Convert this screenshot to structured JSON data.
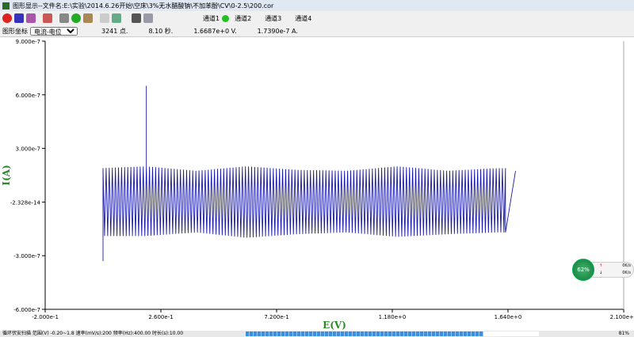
{
  "window": {
    "title": "图形显示--文件名:E:\\实验\\2014.6.26开始\\空床\\3%无水醋酸钠\\不加苯酚\\CV\\0-2.5\\200.cor"
  },
  "toolbar": {
    "channels": [
      "通道1",
      "通道2",
      "通道3",
      "通道4"
    ],
    "active_channel_color": "#22c022"
  },
  "infobar": {
    "label": "图形坐标",
    "mode": "电流-电位",
    "points": "3241 点.",
    "time": "8.10 秒.",
    "potential": "1.6687e+0 V.",
    "current": "1.7390e-7 A."
  },
  "status": {
    "text": "循环伏安扫描  范围(V) -0.20~1.8 速率(mV/s):200 频率(Hz):400.00  时长(s):10.00",
    "progress_percent": 81,
    "progress_label": "81%"
  },
  "widget": {
    "percent": "62%",
    "up": "0K/s",
    "down": "0K/s"
  },
  "chart_data": {
    "type": "line",
    "xlabel": "E(V)",
    "ylabel": "I(A)",
    "xlim": [
      -0.2,
      2.1
    ],
    "ylim": [
      -6e-07,
      9e-07
    ],
    "xticks": [
      "-2.000e-1",
      "2.600e-1",
      "7.200e-1",
      "1.180e+0",
      "1.640e+0",
      "2.100e+0"
    ],
    "xtick_values": [
      -0.2,
      0.26,
      0.72,
      1.18,
      1.64,
      2.1
    ],
    "yticks": [
      "9.000e-7",
      "6.000e-7",
      "3.000e-7",
      "-2.328e-14",
      "-3.000e-7",
      "-6.000e-7"
    ],
    "ytick_values": [
      9e-07,
      6e-07,
      3e-07,
      0,
      -3e-07,
      -6e-07
    ],
    "grid": false,
    "series_color": "#1a1aa8",
    "envelope": {
      "x": [
        0.03,
        0.2,
        0.4,
        0.6,
        0.8,
        1.0,
        1.2,
        1.4,
        1.6,
        1.63
      ],
      "upper": [
        1.9e-07,
        2e-07,
        1.75e-07,
        2e-07,
        1.8e-07,
        1.75e-07,
        2e-07,
        1.75e-07,
        1.9e-07,
        1.9e-07
      ],
      "lower": [
        -1.9e-07,
        -1.9e-07,
        -1.7e-07,
        -2e-07,
        -1.8e-07,
        -1.7e-07,
        -1.95e-07,
        -1.8e-07,
        -1.7e-07,
        -1.7e-07
      ]
    },
    "start_point": [
      0.03,
      -3.3e-07
    ],
    "spike": {
      "x": 0.2,
      "y": 6.5e-07
    },
    "end_segment": [
      [
        1.63,
        -1.7e-07
      ],
      [
        1.67,
        1.74e-07
      ]
    ]
  }
}
